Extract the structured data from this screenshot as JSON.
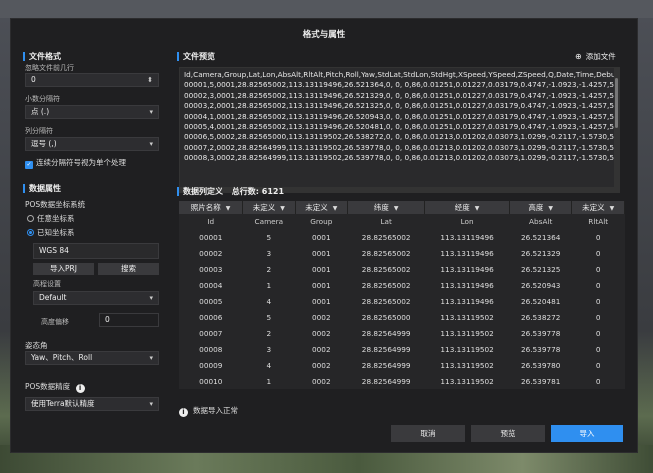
{
  "dialog": {
    "title": "格式与属性"
  },
  "file_format": {
    "section": "文件格式",
    "skip_label": "忽略文件前几行",
    "skip_value": "0",
    "decimal_label": "小数分隔符",
    "decimal_value": "点 (.)",
    "column_label": "列分隔符",
    "column_value": "逗号 (,)",
    "merge_label": "连续分隔符号视为单个处理"
  },
  "data_props": {
    "section": "数据属性",
    "pos_label": "POS数据坐标系统",
    "opt_any": "任意坐标系",
    "opt_known": "已知坐标系",
    "crs_value": "WGS 84",
    "import_prj": "导入PRJ",
    "search": "搜索",
    "elev_label": "高程设置",
    "elev_value": "Default",
    "offset_label": "高度偏移",
    "offset_value": "0"
  },
  "attitude": {
    "section": "姿态角",
    "value": "Yaw、Pitch、Roll"
  },
  "precision": {
    "section": "POS数据精度",
    "value": "使用Terra默认精度"
  },
  "preview": {
    "section": "文件预览",
    "add_file": "添加文件",
    "lines": [
      "Id,Camera,Group,Lat,Lon,AbsAlt,RltAlt,Pitch,Roll,Yaw,StdLat,StdLon,StdHgt,XSpeed,YSpeed,ZSpeed,Q,Date,Time,Debug",
      "00001,5,0001,28.82565002,113.1311949​6,26.521364,0, 0, 0,86,0.01251,0.01227,0.03179,0.4747,-1.0923,-1.4257,50,2021.0",
      "00002,3,0001,28.82565002,113.13119496,26.521329,0, 0, 0,86,0.01251,0.01227,0.03179,0.4747,-1.0923,-1.4257,50,2021.0",
      "00003,2,0001,28.82565002,113.13119496,26.521325,0, 0, 0,86,0.01251,0.01227,0.03179,0.4747,-1.0923,-1.4257,50,2021.0",
      "00004,1,0001,28.82565002,113.13119496,26.520943,0, 0, 0,86,0.01251,0.01227,0.03179,0.4747,-1.0923,-1.4257,50,2021.0",
      "00005,4,0001,28.82565002,113.13119496,26.520481,0, 0, 0,86,0.01251,0.01227,0.03179,0.4747,-1.0923,-1.4257,50,2021.0",
      "00006,5,0002,28.82565000,113.13119502,26.538272,0, 0, 0,86,0.01213,0.01202,0.03073,1.0299,-0.2117,-1.5730,50,2021.0",
      "00007,2,0002,28.82564999,113.13119502,26.539778,0, 0, 0,86,0.01213,0.01202,0.03073,1.0299,-0.2117,-1.5730,50,2021.0",
      "00008,3,0002,28.82564999,113.13119502,26.539778,0, 0, 0,86,0.01213,0.01202,0.03073,1.0299,-0.2117,-1.5730,50,2021.0"
    ]
  },
  "definition": {
    "section": "数据列定义",
    "total": "总行数: 6121",
    "headers": [
      "照片名称",
      "未定义",
      "未定义",
      "纬度",
      "经度",
      "高度",
      "未定义"
    ],
    "subheaders": [
      "Id",
      "Camera",
      "Group",
      "Lat",
      "Lon",
      "AbsAlt",
      "RltAlt"
    ],
    "rows": [
      [
        "00001",
        "5",
        "0001",
        "28.82565002",
        "113.13119496",
        "26.521364",
        "0"
      ],
      [
        "00002",
        "3",
        "0001",
        "28.82565002",
        "113.13119496",
        "26.521329",
        "0"
      ],
      [
        "00003",
        "2",
        "0001",
        "28.82565002",
        "113.13119496",
        "26.521325",
        "0"
      ],
      [
        "00004",
        "1",
        "0001",
        "28.82565002",
        "113.13119496",
        "26.520943",
        "0"
      ],
      [
        "00005",
        "4",
        "0001",
        "28.82565002",
        "113.13119496",
        "26.520481",
        "0"
      ],
      [
        "00006",
        "5",
        "0002",
        "28.82565000",
        "113.13119502",
        "26.538272",
        "0"
      ],
      [
        "00007",
        "2",
        "0002",
        "28.82564999",
        "113.13119502",
        "26.539778",
        "0"
      ],
      [
        "00008",
        "3",
        "0002",
        "28.82564999",
        "113.13119502",
        "26.539778",
        "0"
      ],
      [
        "00009",
        "4",
        "0002",
        "28.82564999",
        "113.13119502",
        "26.539780",
        "0"
      ],
      [
        "00010",
        "1",
        "0002",
        "28.82564999",
        "113.13119502",
        "26.539781",
        "0"
      ]
    ]
  },
  "status": "数据导入正常",
  "footer": {
    "cancel": "取消",
    "preview": "预览",
    "import": "导入"
  },
  "colors": {
    "accent": "#2f8ff0"
  }
}
